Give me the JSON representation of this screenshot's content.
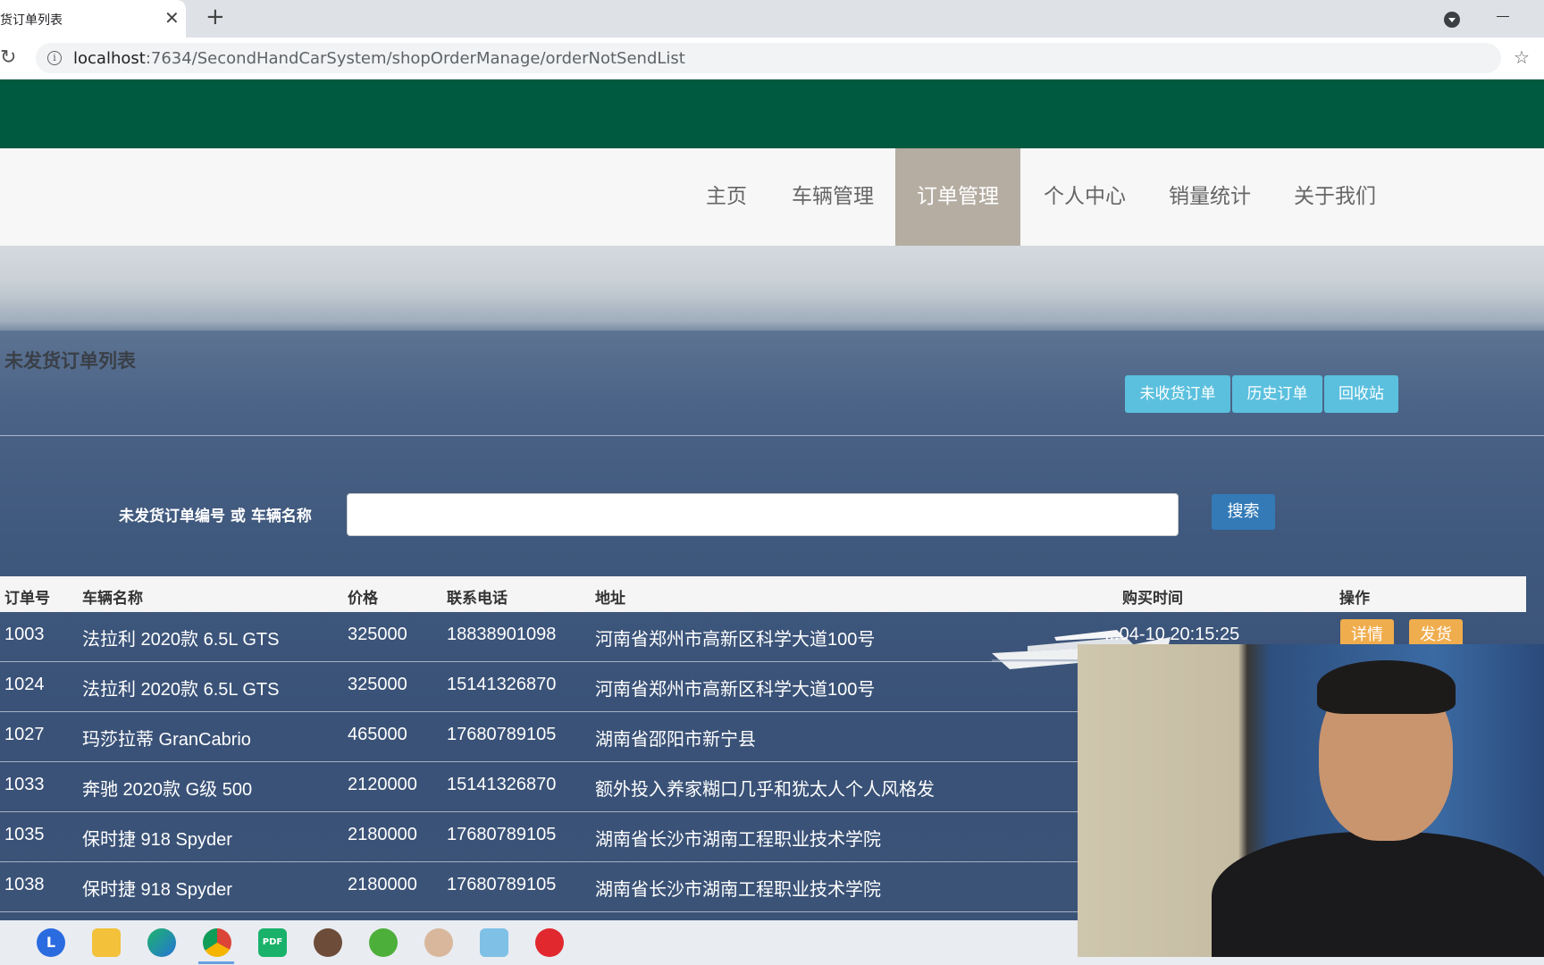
{
  "browser": {
    "tab_title": "未发货订单列表",
    "tab_title_visible": "货订单列表",
    "url_host": "localhost",
    "url_path": ":7634/SecondHandCarSystem/shopOrderManage/orderNotSendList"
  },
  "nav": {
    "items": [
      "主页",
      "车辆管理",
      "订单管理",
      "个人中心",
      "销量统计",
      "关于我们"
    ],
    "active": "订单管理"
  },
  "page": {
    "heading": "未发货订单列表",
    "buttons": [
      "未收货订单",
      "历史订单",
      "回收站"
    ]
  },
  "search": {
    "label": "未发货订单编号 或 车辆名称",
    "value": "",
    "button": "搜索"
  },
  "table": {
    "headers": [
      "订单号",
      "车辆名称",
      "价格",
      "联系电话",
      "地址",
      "购买时间",
      "操作"
    ],
    "rows": [
      {
        "id": "1003",
        "name": "法拉利 2020款 6.5L GTS",
        "price": "325000",
        "phone": "18838901098",
        "address": "河南省郑州市高新区科学大道100号",
        "time": "...04-10 20:15:25"
      },
      {
        "id": "1024",
        "name": "法拉利 2020款 6.5L GTS",
        "price": "325000",
        "phone": "15141326870",
        "address": "河南省郑州市高新区科学大道100号",
        "time": ""
      },
      {
        "id": "1027",
        "name": "玛莎拉蒂 GranCabrio",
        "price": "465000",
        "phone": "17680789105",
        "address": "湖南省邵阳市新宁县",
        "time": ""
      },
      {
        "id": "1033",
        "name": "奔驰 2020款 G级 500",
        "price": "2120000",
        "phone": "15141326870",
        "address": "额外投入养家糊口几乎和犹太人个人风格发",
        "time": ""
      },
      {
        "id": "1035",
        "name": "保时捷 918 Spyder",
        "price": "2180000",
        "phone": "17680789105",
        "address": "湖南省长沙市湖南工程职业技术学院",
        "time": ""
      },
      {
        "id": "1038",
        "name": "保时捷 918 Spyder",
        "price": "2180000",
        "phone": "17680789105",
        "address": "湖南省长沙市湖南工程职业技术学院",
        "time": ""
      }
    ],
    "actions": [
      "详情",
      "发货"
    ]
  },
  "taskbar": {
    "icons": [
      "lenovo-icon",
      "file-explorer-icon",
      "edge-icon",
      "chrome-icon",
      "pdf-icon",
      "app-icon",
      "green-app-icon",
      "avatar-app-icon",
      "notes-icon",
      "netease-music-icon"
    ],
    "pdf_label": "PDF"
  },
  "colors": {
    "brand_green": "#005a3f",
    "nav_active": "#b5ada2",
    "btn_info": "#5bc0de",
    "btn_primary": "#337ab7",
    "btn_warning": "#f0ad4e"
  }
}
